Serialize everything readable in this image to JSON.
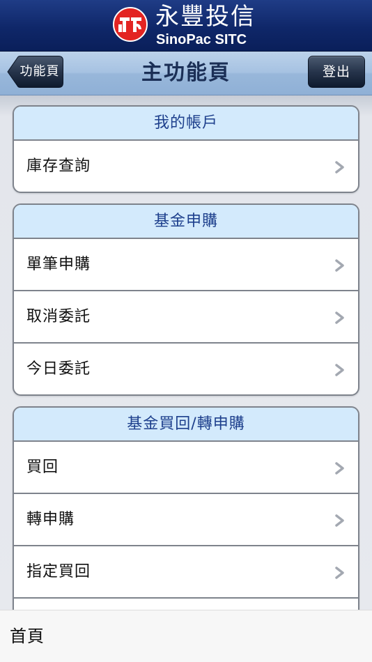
{
  "brand": {
    "name_cn": "永豐投信",
    "name_en": "SinoPac SITC",
    "logo_icon": "sinopac-logo-icon",
    "colors": {
      "header": "#0f2769",
      "logo_red": "#e32422"
    }
  },
  "nav": {
    "back_label": "功能頁",
    "title": "主功能頁",
    "logout_label": "登出"
  },
  "sections": [
    {
      "title": "我的帳戶",
      "items": [
        {
          "label": "庫存查詢"
        }
      ]
    },
    {
      "title": "基金申購",
      "items": [
        {
          "label": "單筆申購"
        },
        {
          "label": "取消委託"
        },
        {
          "label": "今日委託"
        }
      ]
    },
    {
      "title": "基金買回/轉申購",
      "items": [
        {
          "label": "買回"
        },
        {
          "label": "轉申購"
        },
        {
          "label": "指定買回"
        },
        {
          "label": ""
        }
      ]
    }
  ],
  "bottom": {
    "label": "首頁"
  },
  "colors": {
    "section_header_bg": "#d3eafc",
    "section_header_text": "#1d3f8c",
    "chevron": "#a3a8b1"
  }
}
